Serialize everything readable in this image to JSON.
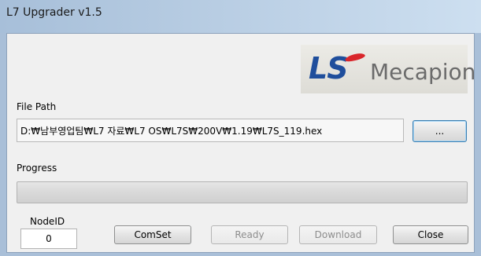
{
  "window": {
    "title": "L7 Upgrader v1.5"
  },
  "logo": {
    "ls": "LS",
    "mecapion": "Mecapion",
    "ls_color": "#1f4e9c",
    "mecapion_color": "#6b6b6b",
    "swoosh_color": "#d9262b"
  },
  "file_path": {
    "label": "File Path",
    "value": "D:₩남부영업팀₩L7 자료₩L7 OS₩L7S₩200V₩1.19₩L7S_119.hex",
    "browse_label": "..."
  },
  "progress": {
    "label": "Progress",
    "value": 0
  },
  "node_id": {
    "label": "NodeID",
    "value": "0"
  },
  "buttons": {
    "comset": "ComSet",
    "ready": "Ready",
    "download": "Download",
    "close": "Close"
  }
}
